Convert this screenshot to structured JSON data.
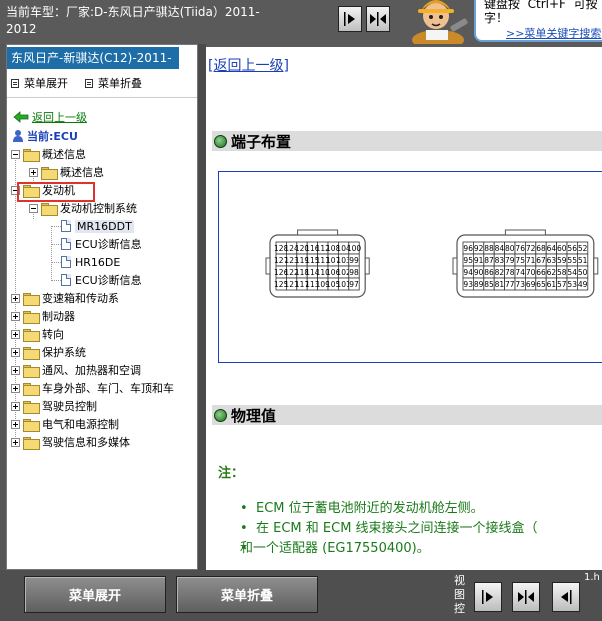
{
  "topbar": {
    "car_model": "当前车型：厂家:D-东风日产骐达(Tiida）2011-2012",
    "hint_text": "键盘按  Ctrl+F  可按\n字！",
    "hint_link": ">>菜单关键字搜索"
  },
  "left_pane": {
    "header": "东风日产-新骐达(C12)-2011-",
    "menu_expand": "菜单展开",
    "menu_collapse": "菜单折叠",
    "back_up": "返回上一级",
    "current": "当前:ECU",
    "tree": [
      {
        "label": "概述信息",
        "level": 0,
        "toggle": "minus",
        "icon": "folder"
      },
      {
        "label": "概述信息",
        "level": 1,
        "toggle": "plus",
        "icon": "folder"
      },
      {
        "label": "发动机",
        "level": 0,
        "toggle": "minus",
        "icon": "folder"
      },
      {
        "label": "发动机控制系统",
        "level": 1,
        "toggle": "minus",
        "icon": "folder"
      },
      {
        "label": "MR16DDT",
        "level": 2,
        "toggle": "",
        "icon": "page",
        "selected": true
      },
      {
        "label": "ECU诊断信息",
        "level": 2,
        "toggle": "",
        "icon": "page"
      },
      {
        "label": "HR16DE",
        "level": 2,
        "toggle": "",
        "icon": "page"
      },
      {
        "label": "ECU诊断信息",
        "level": 2,
        "toggle": "",
        "icon": "page"
      },
      {
        "label": "变速箱和传动系",
        "level": 0,
        "toggle": "plus",
        "icon": "folder"
      },
      {
        "label": "制动器",
        "level": 0,
        "toggle": "plus",
        "icon": "folder"
      },
      {
        "label": "转向",
        "level": 0,
        "toggle": "plus",
        "icon": "folder"
      },
      {
        "label": "保护系统",
        "level": 0,
        "toggle": "plus",
        "icon": "folder"
      },
      {
        "label": "通风、加热器和空调",
        "level": 0,
        "toggle": "plus",
        "icon": "folder"
      },
      {
        "label": "车身外部、车门、车顶和车",
        "level": 0,
        "toggle": "plus",
        "icon": "folder"
      },
      {
        "label": "驾驶员控制",
        "level": 0,
        "toggle": "plus",
        "icon": "folder"
      },
      {
        "label": "电气和电源控制",
        "level": 0,
        "toggle": "plus",
        "icon": "folder"
      },
      {
        "label": "驾驶信息和多媒体",
        "level": 0,
        "toggle": "plus",
        "icon": "folder"
      }
    ]
  },
  "right_pane": {
    "back_link": "[返回上一级]",
    "section_terminal": "端子布置",
    "section_physical": "物理值",
    "note_label": "注：",
    "notes": [
      "ECM 位于蓄电池附近的发动机舱左侧。",
      "在  ECM 和  ECM 线束接头之间连接一个接线盒（",
      "和一个适配器 (EG17550400)。"
    ],
    "connector_left": [
      [
        "128",
        "124",
        "120",
        "116",
        "112",
        "108",
        "104",
        "100"
      ],
      [
        "127",
        "123",
        "119",
        "115",
        "111",
        "107",
        "103",
        "99"
      ],
      [
        "126",
        "122",
        "118",
        "114",
        "110",
        "106",
        "102",
        "98"
      ],
      [
        "125",
        "121",
        "117",
        "113",
        "109",
        "105",
        "101",
        "97"
      ]
    ],
    "connector_right": [
      [
        "96",
        "92",
        "88",
        "84",
        "80",
        "76",
        "72",
        "68",
        "64",
        "60",
        "56",
        "52"
      ],
      [
        "95",
        "91",
        "87",
        "83",
        "79",
        "75",
        "71",
        "67",
        "63",
        "59",
        "55",
        "51"
      ],
      [
        "94",
        "90",
        "86",
        "82",
        "78",
        "74",
        "70",
        "66",
        "62",
        "58",
        "54",
        "50"
      ],
      [
        "93",
        "89",
        "85",
        "81",
        "77",
        "73",
        "69",
        "65",
        "61",
        "57",
        "53",
        "49"
      ]
    ]
  },
  "bottombar": {
    "menu_expand": "菜单展开",
    "menu_collapse": "菜单折叠",
    "view_label": "视图控",
    "extra": "1.h"
  }
}
